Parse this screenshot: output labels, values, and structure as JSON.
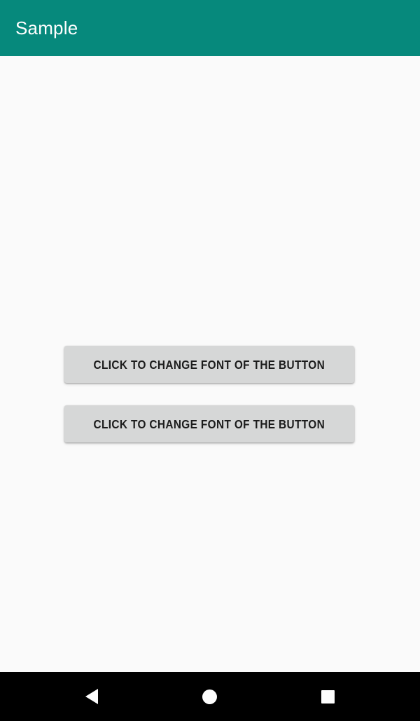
{
  "app": {
    "title": "Sample",
    "appbar_color": "#06897c",
    "background_color": "#fafafa"
  },
  "content": {
    "buttons": [
      {
        "label": "Click to change font of the button",
        "background_color": "#d6d7d7",
        "text_color": "#1c1c1c"
      },
      {
        "label": "Click to change font of the button",
        "background_color": "#d6d7d7",
        "text_color": "#1c1c1c"
      }
    ]
  },
  "navbar": {
    "background_color": "#000000",
    "keys": [
      {
        "name": "back",
        "icon": "triangle-left-icon"
      },
      {
        "name": "home",
        "icon": "circle-icon"
      },
      {
        "name": "recents",
        "icon": "square-icon"
      }
    ]
  }
}
